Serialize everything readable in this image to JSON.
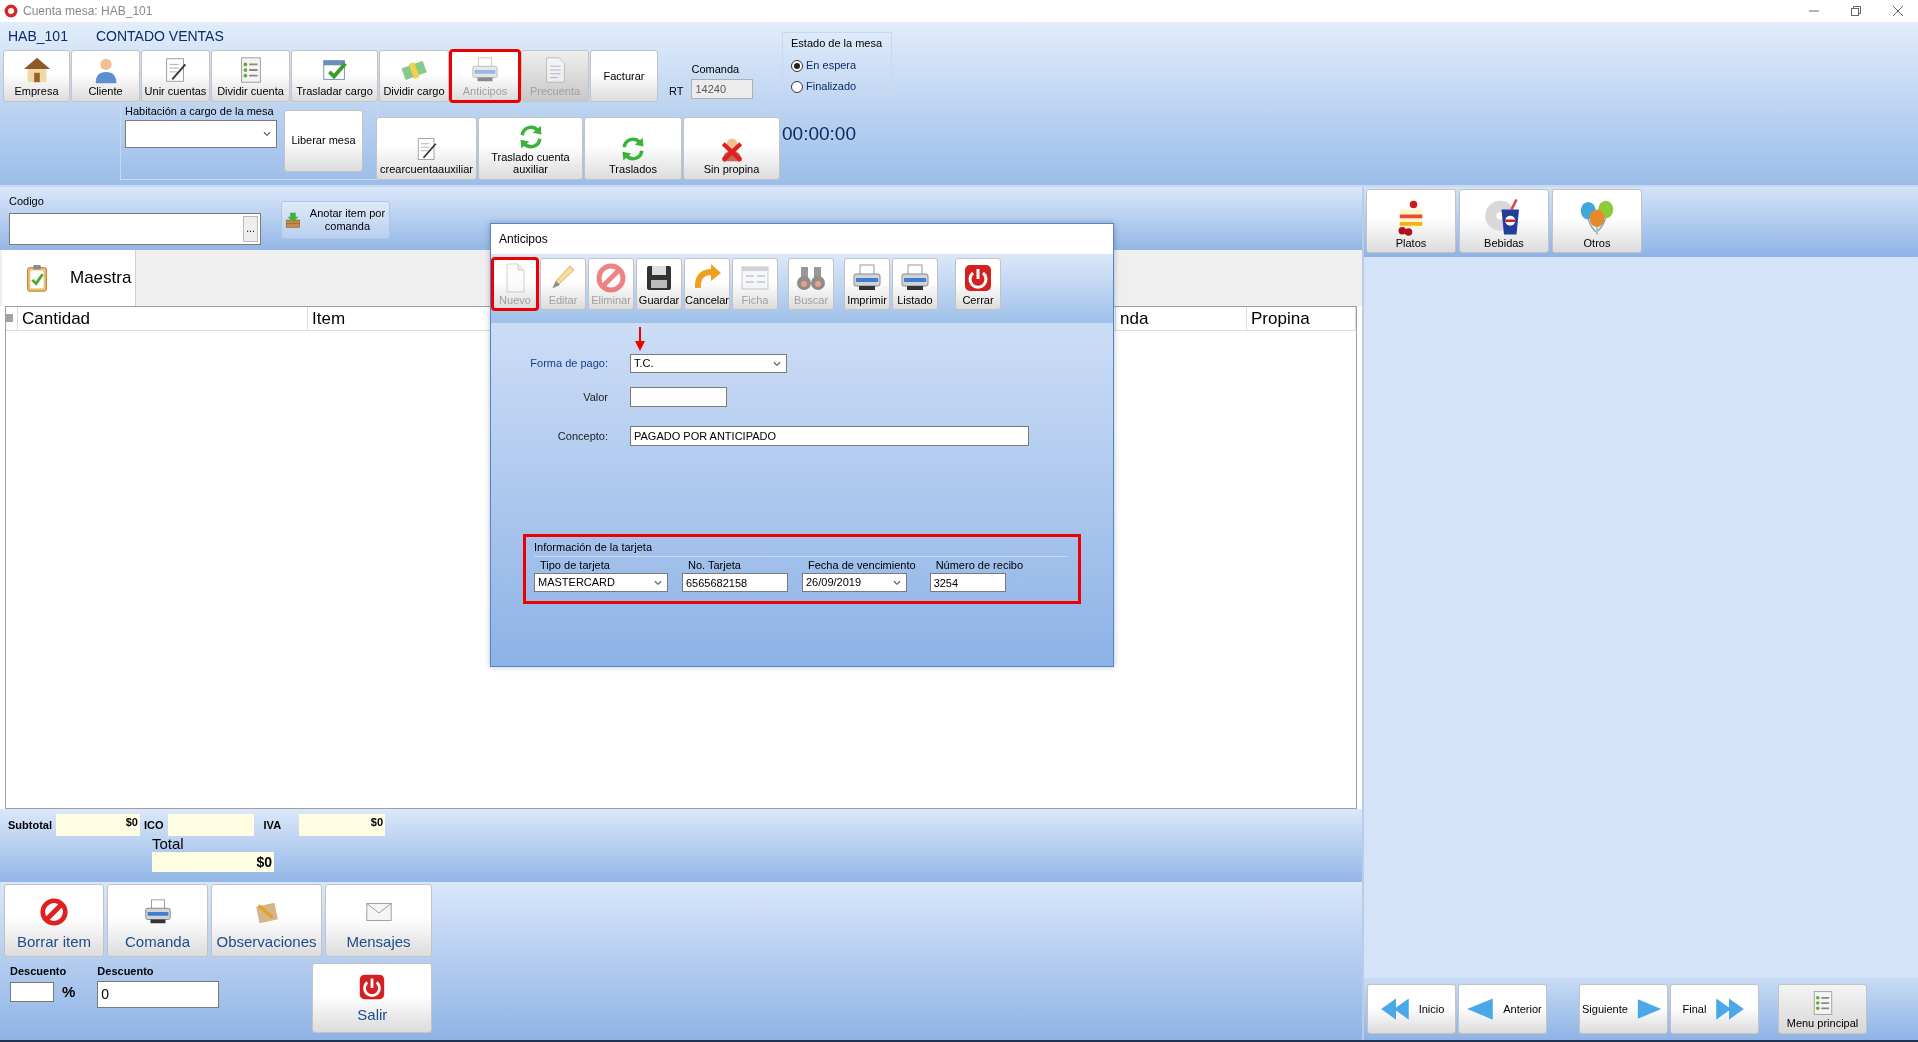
{
  "window": {
    "title": "Cuenta mesa: HAB_101"
  },
  "header": {
    "room": "HAB_101",
    "account_type": "CONTADO VENTAS"
  },
  "toolbar": [
    {
      "label": "Empresa",
      "disabled": false,
      "highlighted": false
    },
    {
      "label": "Cliente",
      "disabled": false,
      "highlighted": false
    },
    {
      "label": "Unir cuentas",
      "disabled": false,
      "highlighted": false
    },
    {
      "label": "Dividir cuenta",
      "disabled": false,
      "highlighted": false
    },
    {
      "label": "Trasladar cargo",
      "disabled": false,
      "highlighted": false
    },
    {
      "label": "Dividir cargo",
      "disabled": false,
      "highlighted": false
    },
    {
      "label": "Anticipos",
      "disabled": true,
      "highlighted": true
    },
    {
      "label": "Precuenta",
      "disabled": true,
      "highlighted": false
    },
    {
      "label": "Facturar",
      "disabled": false,
      "highlighted": false
    }
  ],
  "comanda": {
    "prefix": "RT",
    "label": "Comanda",
    "value": "14240",
    "disabled": true
  },
  "estado": {
    "title": "Estado de la mesa",
    "options": [
      {
        "label": "En espera",
        "selected": true
      },
      {
        "label": "Finalizado",
        "selected": false
      }
    ]
  },
  "habitacion": {
    "label": "Habitación a cargo de la mesa",
    "button": "Liberar mesa"
  },
  "actions": [
    {
      "label": "crearcuentaauxiliar"
    },
    {
      "label": "Traslado cuenta auxiliar"
    },
    {
      "label": "Traslados"
    },
    {
      "label": "Sin propina"
    }
  ],
  "timer": "00:00:00",
  "codigo": {
    "label": "Codigo",
    "lookup_button": "...",
    "add_button": "Anotar item por comanda"
  },
  "tabs": [
    {
      "label": "Maestra",
      "selected": true
    }
  ],
  "table": {
    "columns": [
      "Cantidad",
      "Item",
      "nda",
      "Propina"
    ]
  },
  "totals": {
    "subtotal_label": "Subtotal",
    "subtotal": "$0",
    "ico_label": "ICO",
    "iva_label": "IVA",
    "iva": "$0",
    "total_label": "Total",
    "total": "$0"
  },
  "bottom_buttons": [
    {
      "label": "Borrar item"
    },
    {
      "label": "Comanda"
    },
    {
      "label": "Observaciones"
    },
    {
      "label": "Mensajes"
    }
  ],
  "descuento": {
    "percent_label": "Descuento",
    "percent_sign": "%",
    "amount_label": "Descuento",
    "amount": "0"
  },
  "exit_button": "Salir",
  "categories": [
    {
      "label": "Platos"
    },
    {
      "label": "Bebidas"
    },
    {
      "label": "Otros"
    }
  ],
  "nav": [
    {
      "label": "Inicio"
    },
    {
      "label": "Anterior"
    },
    {
      "label": "Siguiente"
    },
    {
      "label": "Final"
    },
    {
      "label": "Menu principal"
    }
  ],
  "dialog": {
    "title": "Anticipos",
    "toolbar": [
      {
        "label": "Nuevo",
        "disabled": true,
        "highlighted": true
      },
      {
        "label": "Editar",
        "disabled": true,
        "highlighted": false
      },
      {
        "label": "Eliminar",
        "disabled": true,
        "highlighted": false
      },
      {
        "label": "Guardar",
        "disabled": false,
        "highlighted": false
      },
      {
        "label": "Cancelar",
        "disabled": false,
        "highlighted": false
      },
      {
        "label": "Ficha",
        "disabled": true,
        "highlighted": false
      },
      {
        "label": "Buscar",
        "disabled": true,
        "highlighted": false
      },
      {
        "label": "Imprimir",
        "disabled": false,
        "highlighted": false
      },
      {
        "label": "Listado",
        "disabled": false,
        "highlighted": false
      },
      {
        "label": "Cerrar",
        "disabled": false,
        "highlighted": false
      }
    ],
    "forma_pago": {
      "label": "Forma de pago:",
      "value": "T.C.",
      "arrow": true
    },
    "valor": {
      "label": "Valor"
    },
    "concepto": {
      "label": "Concepto:",
      "value": "PAGADO POR ANTICIPADO"
    },
    "card": {
      "title": "Información de la tarjeta",
      "highlighted": true,
      "fields": [
        {
          "kind": "select",
          "label": "Tipo de tarjeta",
          "value": "MASTERCARD"
        },
        {
          "kind": "text",
          "label": "No. Tarjeta",
          "value": "6565682158"
        },
        {
          "kind": "date",
          "label": "Fecha de vencimiento",
          "value": "26/09/2019"
        },
        {
          "kind": "text",
          "label": "Número de recibo",
          "value": "3254"
        }
      ]
    }
  }
}
